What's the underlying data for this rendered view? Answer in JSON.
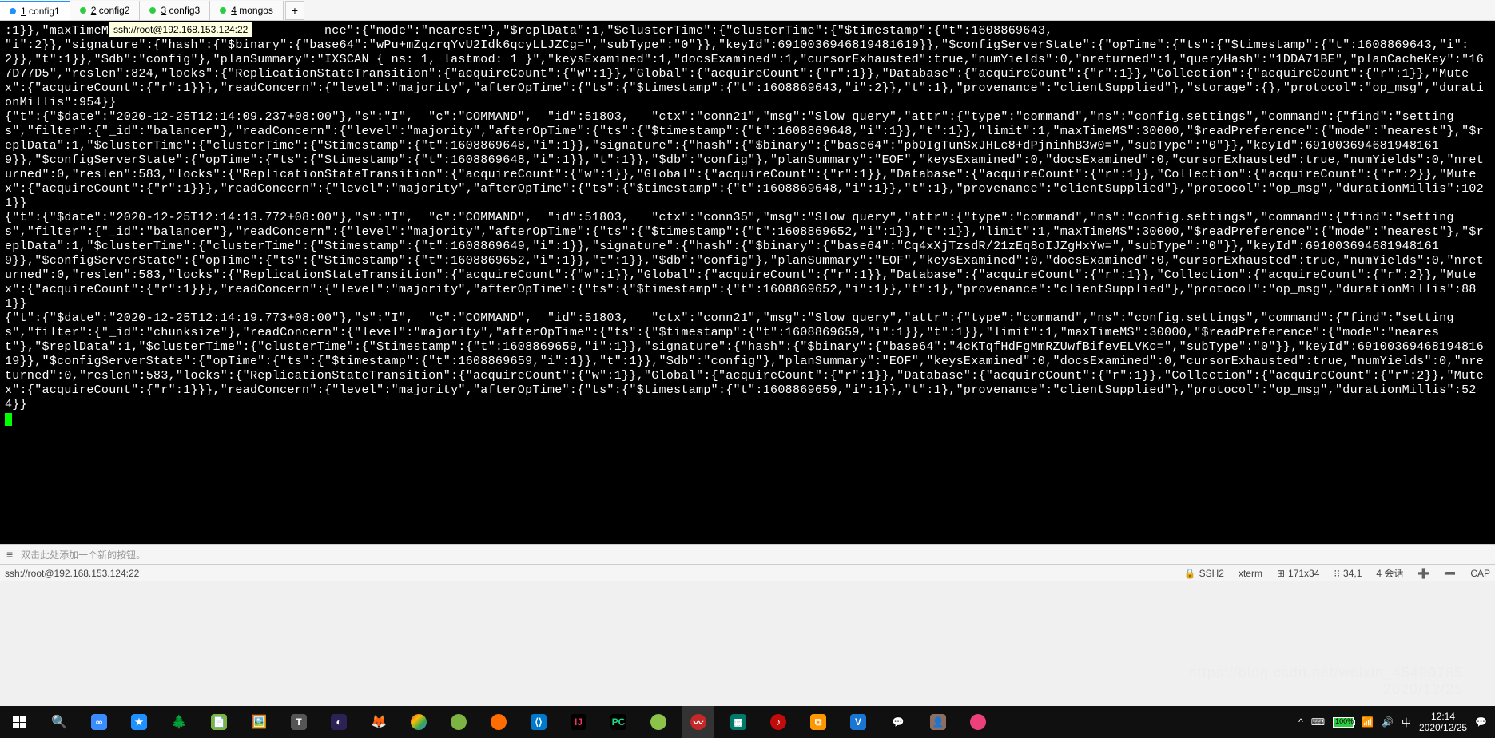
{
  "tabs": [
    {
      "num": "1",
      "label": "config1",
      "active": true
    },
    {
      "num": "2",
      "label": "config2",
      "active": false
    },
    {
      "num": "3",
      "label": "config3",
      "active": false
    },
    {
      "num": "4",
      "label": "mongos",
      "active": false
    }
  ],
  "newtab_label": "+",
  "tooltip": "ssh://root@192.168.153.124:22",
  "terminal_lines": [
    ":1}},\"maxTimeM                             nce\":{\"mode\":\"nearest\"},\"$replData\":1,\"$clusterTime\":{\"clusterTime\":{\"$timestamp\":{\"t\":1608869643,",
    "\"i\":2}},\"signature\":{\"hash\":{\"$binary\":{\"base64\":\"wPu+mZqzrqYvU2Idk6qcyLLJZCg=\",\"subType\":\"0\"}},\"keyId\":6910036946819481619}},\"$configServerState\":{\"opTime\":{\"ts\":{\"$timestamp\":{\"t\":1608869643,\"i\":2}},\"t\":1}},\"$db\":\"config\"},\"planSummary\":\"IXSCAN { ns: 1, lastmod: 1 }\",\"keysExamined\":1,\"docsExamined\":1,\"cursorExhausted\":true,\"numYields\":0,\"nreturned\":1,\"queryHash\":\"1DDA71BE\",\"planCacheKey\":\"167D77D5\",\"reslen\":824,\"locks\":{\"ReplicationStateTransition\":{\"acquireCount\":{\"w\":1}},\"Global\":{\"acquireCount\":{\"r\":1}},\"Database\":{\"acquireCount\":{\"r\":1}},\"Collection\":{\"acquireCount\":{\"r\":1}},\"Mutex\":{\"acquireCount\":{\"r\":1}}},\"readConcern\":{\"level\":\"majority\",\"afterOpTime\":{\"ts\":{\"$timestamp\":{\"t\":1608869643,\"i\":2}},\"t\":1},\"provenance\":\"clientSupplied\"},\"storage\":{},\"protocol\":\"op_msg\",\"durationMillis\":954}}",
    "{\"t\":{\"$date\":\"2020-12-25T12:14:09.237+08:00\"},\"s\":\"I\",  \"c\":\"COMMAND\",  \"id\":51803,   \"ctx\":\"conn21\",\"msg\":\"Slow query\",\"attr\":{\"type\":\"command\",\"ns\":\"config.settings\",\"command\":{\"find\":\"settings\",\"filter\":{\"_id\":\"balancer\"},\"readConcern\":{\"level\":\"majority\",\"afterOpTime\":{\"ts\":{\"$timestamp\":{\"t\":1608869648,\"i\":1}},\"t\":1}},\"limit\":1,\"maxTimeMS\":30000,\"$readPreference\":{\"mode\":\"nearest\"},\"$replData\":1,\"$clusterTime\":{\"clusterTime\":{\"$timestamp\":{\"t\":1608869648,\"i\":1}},\"signature\":{\"hash\":{\"$binary\":{\"base64\":\"pbOIgTunSxJHLc8+dPjninhB3w0=\",\"subType\":\"0\"}},\"keyId\":6910036946819481619}},\"$configServerState\":{\"opTime\":{\"ts\":{\"$timestamp\":{\"t\":1608869648,\"i\":1}},\"t\":1}},\"$db\":\"config\"},\"planSummary\":\"EOF\",\"keysExamined\":0,\"docsExamined\":0,\"cursorExhausted\":true,\"numYields\":0,\"nreturned\":0,\"reslen\":583,\"locks\":{\"ReplicationStateTransition\":{\"acquireCount\":{\"w\":1}},\"Global\":{\"acquireCount\":{\"r\":1}},\"Database\":{\"acquireCount\":{\"r\":1}},\"Collection\":{\"acquireCount\":{\"r\":2}},\"Mutex\":{\"acquireCount\":{\"r\":1}}},\"readConcern\":{\"level\":\"majority\",\"afterOpTime\":{\"ts\":{\"$timestamp\":{\"t\":1608869648,\"i\":1}},\"t\":1},\"provenance\":\"clientSupplied\"},\"protocol\":\"op_msg\",\"durationMillis\":1021}}",
    "{\"t\":{\"$date\":\"2020-12-25T12:14:13.772+08:00\"},\"s\":\"I\",  \"c\":\"COMMAND\",  \"id\":51803,   \"ctx\":\"conn35\",\"msg\":\"Slow query\",\"attr\":{\"type\":\"command\",\"ns\":\"config.settings\",\"command\":{\"find\":\"settings\",\"filter\":{\"_id\":\"balancer\"},\"readConcern\":{\"level\":\"majority\",\"afterOpTime\":{\"ts\":{\"$timestamp\":{\"t\":1608869652,\"i\":1}},\"t\":1}},\"limit\":1,\"maxTimeMS\":30000,\"$readPreference\":{\"mode\":\"nearest\"},\"$replData\":1,\"$clusterTime\":{\"clusterTime\":{\"$timestamp\":{\"t\":1608869649,\"i\":1}},\"signature\":{\"hash\":{\"$binary\":{\"base64\":\"Cq4xXjTzsdR/21zEq8oIJZgHxYw=\",\"subType\":\"0\"}},\"keyId\":6910036946819481619}},\"$configServerState\":{\"opTime\":{\"ts\":{\"$timestamp\":{\"t\":1608869652,\"i\":1}},\"t\":1}},\"$db\":\"config\"},\"planSummary\":\"EOF\",\"keysExamined\":0,\"docsExamined\":0,\"cursorExhausted\":true,\"numYields\":0,\"nreturned\":0,\"reslen\":583,\"locks\":{\"ReplicationStateTransition\":{\"acquireCount\":{\"w\":1}},\"Global\":{\"acquireCount\":{\"r\":1}},\"Database\":{\"acquireCount\":{\"r\":1}},\"Collection\":{\"acquireCount\":{\"r\":2}},\"Mutex\":{\"acquireCount\":{\"r\":1}}},\"readConcern\":{\"level\":\"majority\",\"afterOpTime\":{\"ts\":{\"$timestamp\":{\"t\":1608869652,\"i\":1}},\"t\":1},\"provenance\":\"clientSupplied\"},\"protocol\":\"op_msg\",\"durationMillis\":881}}",
    "{\"t\":{\"$date\":\"2020-12-25T12:14:19.773+08:00\"},\"s\":\"I\",  \"c\":\"COMMAND\",  \"id\":51803,   \"ctx\":\"conn21\",\"msg\":\"Slow query\",\"attr\":{\"type\":\"command\",\"ns\":\"config.settings\",\"command\":{\"find\":\"settings\",\"filter\":{\"_id\":\"chunksize\"},\"readConcern\":{\"level\":\"majority\",\"afterOpTime\":{\"ts\":{\"$timestamp\":{\"t\":1608869659,\"i\":1}},\"t\":1}},\"limit\":1,\"maxTimeMS\":30000,\"$readPreference\":{\"mode\":\"nearest\"},\"$replData\":1,\"$clusterTime\":{\"clusterTime\":{\"$timestamp\":{\"t\":1608869659,\"i\":1}},\"signature\":{\"hash\":{\"$binary\":{\"base64\":\"4cKTqfHdFgMmRZUwfBifevELVKc=\",\"subType\":\"0\"}},\"keyId\":6910036946819481619}},\"$configServerState\":{\"opTime\":{\"ts\":{\"$timestamp\":{\"t\":1608869659,\"i\":1}},\"t\":1}},\"$db\":\"config\"},\"planSummary\":\"EOF\",\"keysExamined\":0,\"docsExamined\":0,\"cursorExhausted\":true,\"numYields\":0,\"nreturned\":0,\"reslen\":583,\"locks\":{\"ReplicationStateTransition\":{\"acquireCount\":{\"w\":1}},\"Global\":{\"acquireCount\":{\"r\":1}},\"Database\":{\"acquireCount\":{\"r\":1}},\"Collection\":{\"acquireCount\":{\"r\":2}},\"Mutex\":{\"acquireCount\":{\"r\":1}}},\"readConcern\":{\"level\":\"majority\",\"afterOpTime\":{\"ts\":{\"$timestamp\":{\"t\":1608869659,\"i\":1}},\"t\":1},\"provenance\":\"clientSupplied\"},\"protocol\":\"op_msg\",\"durationMillis\":524}}"
  ],
  "button_bar_hint": "双击此处添加一个新的按钮。",
  "status": {
    "conn": "ssh://root@192.168.153.124:22",
    "proto": "SSH2",
    "term": "xterm",
    "size": "171x34",
    "pos": "34,1",
    "sessions": "4 会话",
    "cap": "CAP"
  },
  "watermark": {
    "url": "https://blog.csdn.net/weixin_45490785",
    "date": "2020/12/25"
  },
  "tray": {
    "battery_pct": "100%",
    "time": "12:14",
    "date": "2020/12/25"
  }
}
